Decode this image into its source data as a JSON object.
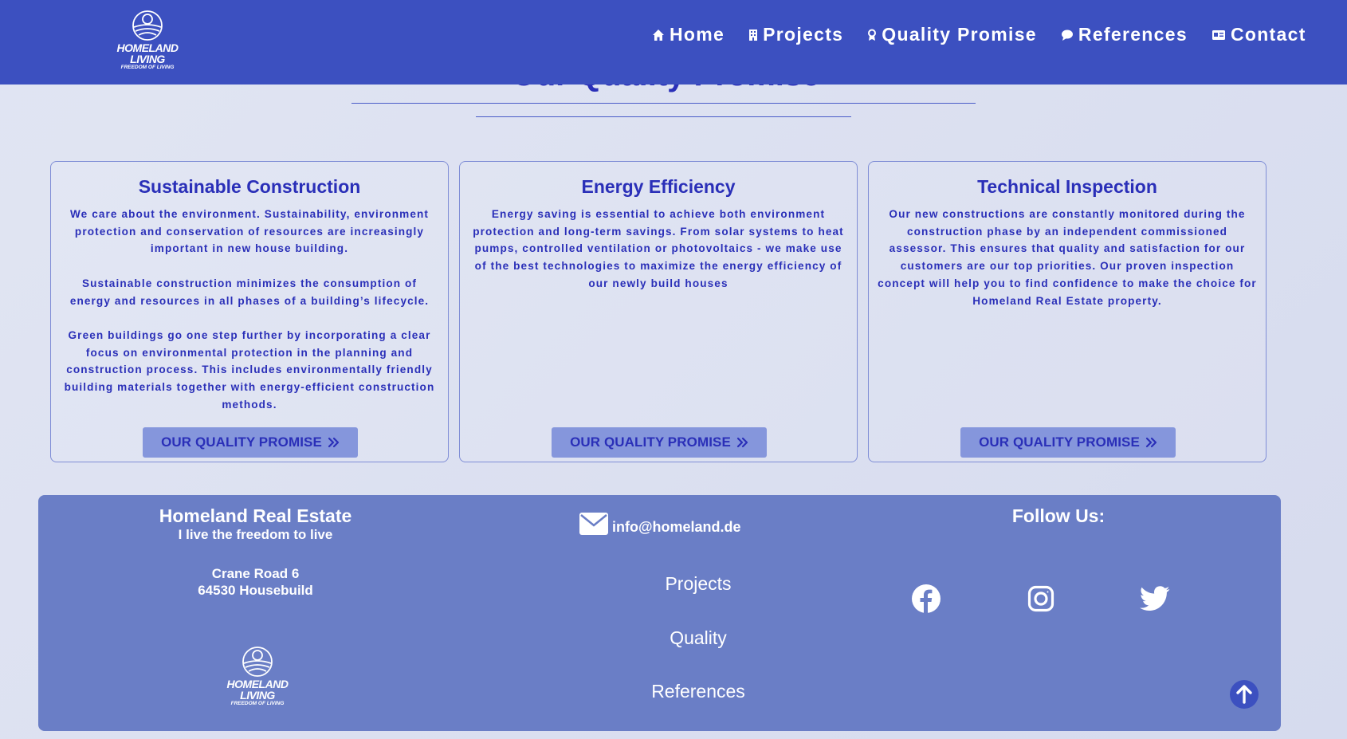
{
  "header": {
    "logo": {
      "name": "HOMELAND LIVING",
      "tagline": "FREEDOM OF LIVING"
    },
    "nav": [
      {
        "label": "Home",
        "icon": "home-icon"
      },
      {
        "label": "Projects",
        "icon": "building-icon"
      },
      {
        "label": "Quality Promise",
        "icon": "award-icon"
      },
      {
        "label": "References",
        "icon": "chat-bubble-icon"
      },
      {
        "label": "Contact",
        "icon": "contact-card-icon"
      }
    ]
  },
  "section": {
    "title": "Our Quality Promise"
  },
  "cards": [
    {
      "title": "Sustainable Construction",
      "paragraphs": [
        "We care about the environment. Sustainability, environment protection and conservation of resources are increasingly important in new house building.",
        "Sustainable construction minimizes the consumption of energy and resources in all phases of a building’s lifecycle.",
        "Green buildings go one step further by incorporating a clear focus on environmental protection in the planning and construction process. This includes environmentally friendly building materials together with energy-efficient construction methods."
      ],
      "button": "OUR QUALITY PROMISE"
    },
    {
      "title": "Energy Efficiency",
      "paragraphs": [
        "Energy saving is essential to achieve both environment protection and long-term savings. From solar systems to heat pumps, controlled ventilation or photovoltaics - we make use of the best technologies to maximize the energy efficiency of our newly build houses"
      ],
      "button": "OUR QUALITY PROMISE"
    },
    {
      "title": "Technical Inspection",
      "paragraphs": [
        "Our new constructions are constantly monitored during the construction phase by an independent commissioned assessor. This ensures that quality and satisfaction for our customers are our top priorities. Our proven inspection concept will help you to find confidence to make the choice for Homeland Real Estate property."
      ],
      "button": "OUR QUALITY PROMISE"
    }
  ],
  "footer": {
    "company": "Homeland Real Estate",
    "tagline": "I live the freedom to live",
    "street": "Crane Road 6",
    "city": "64530 Housebuild",
    "logo": {
      "name": "HOMELAND LIVING",
      "tagline": "FREEDOM OF LIVING"
    },
    "email": "info@homeland.de",
    "links": [
      "Projects",
      "Quality",
      "References"
    ],
    "follow": "Follow Us:",
    "social": [
      "facebook-icon",
      "instagram-icon",
      "twitter-icon"
    ]
  },
  "colors": {
    "header_bg": "#3c50c0",
    "accent_text": "#2a2fb8",
    "footer_bg": "#6a7ec6",
    "button_bg": "#8596dc"
  }
}
